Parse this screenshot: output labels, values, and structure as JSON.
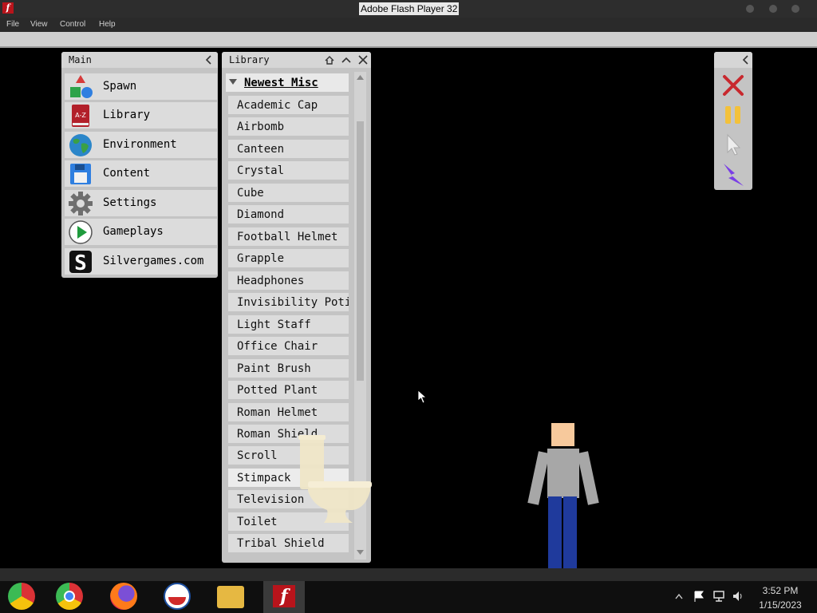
{
  "window": {
    "title": "Adobe Flash Player 32",
    "app_icon": "f"
  },
  "menubar": {
    "items": [
      "File",
      "View",
      "Control",
      "Help"
    ]
  },
  "main_panel": {
    "title": "Main",
    "items": [
      {
        "label": "Spawn",
        "icon": "spawn-icon"
      },
      {
        "label": "Library",
        "icon": "library-book-icon",
        "icon_text": "A-Z"
      },
      {
        "label": "Environment",
        "icon": "globe-icon"
      },
      {
        "label": "Content",
        "icon": "floppy-disk-icon"
      },
      {
        "label": "Settings",
        "icon": "gear-icon"
      },
      {
        "label": "Gameplays",
        "icon": "play-icon"
      },
      {
        "label": "Silvergames.com",
        "icon": "silvergames-logo-icon",
        "icon_text": "S"
      }
    ]
  },
  "library_panel": {
    "title": "Library",
    "category": "Newest Misc",
    "items": [
      "Academic Cap",
      "Airbomb",
      "Canteen",
      "Crystal",
      "Cube",
      "Diamond",
      "Football Helmet",
      "Grapple",
      "Headphones",
      "Invisibility Potion",
      "Light Staff",
      "Office Chair",
      "Paint Brush",
      "Potted Plant",
      "Roman Helmet",
      "Roman Shield",
      "Scroll",
      "Stimpack",
      "Television",
      "Toilet",
      "Tribal Shield"
    ]
  },
  "tools_panel": {
    "tools": [
      "close-x-icon",
      "pause-icon",
      "cursor-icon",
      "lightning-icon"
    ]
  },
  "taskbar": {
    "apps": [
      "chrome-old-icon",
      "chrome-icon",
      "firefox-icon",
      "obama-logo-icon",
      "file-explorer-icon",
      "flash-player-icon"
    ],
    "time": "3:52 PM",
    "date": "1/15/2023"
  },
  "colors": {
    "accent_red": "#c8282e",
    "pause_yellow": "#f3c13a",
    "lightning_purple": "#7a3ee6",
    "jeans_blue": "#1f3a9c"
  }
}
